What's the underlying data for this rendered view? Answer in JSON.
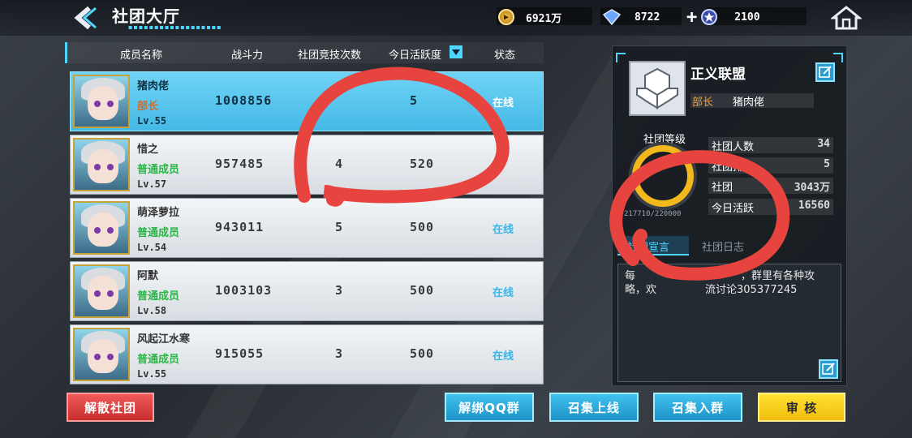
{
  "header": {
    "title": "社团大厅",
    "gold": "6921万",
    "gems": "8722",
    "tickets": "2100",
    "colors": {
      "accent": "#4fd6ff",
      "gold": "#f6c24b"
    }
  },
  "columns": [
    "成员名称",
    "战斗力",
    "社团竞技次数",
    "今日活跃度",
    "状态"
  ],
  "members": [
    {
      "name": "猪肉佬",
      "rank": "部长",
      "level": "Lv.55",
      "power": "1008856",
      "count": "",
      "activity": "5",
      "status": "在线"
    },
    {
      "name": "惜之",
      "rank": "普通成员",
      "level": "Lv.57",
      "power": "957485",
      "count": "4",
      "activity": "520",
      "status": ""
    },
    {
      "name": "萌泽萝拉",
      "rank": "普通成员",
      "level": "Lv.54",
      "power": "943011",
      "count": "5",
      "activity": "500",
      "status": "在线"
    },
    {
      "name": "阿默",
      "rank": "普通成员",
      "level": "Lv.58",
      "power": "1003103",
      "count": "3",
      "activity": "500",
      "status": "在线"
    },
    {
      "name": "风起江水寒",
      "rank": "普通成员",
      "level": "Lv.55",
      "power": "915055",
      "count": "3",
      "activity": "500",
      "status": "在线"
    }
  ],
  "club": {
    "name": "正义联盟",
    "leader_label": "部长",
    "leader_name": "猪肉佬",
    "level_label": "社团等级",
    "exp": "217710/220000",
    "stats": [
      {
        "k": "社团人数",
        "v": "34"
      },
      {
        "k": "社团排名",
        "v": "5"
      },
      {
        "k": "社团",
        "v": "3043万"
      },
      {
        "k": "今日活跃",
        "v": "16560"
      }
    ],
    "tab_active": "社团宣言",
    "tab_inactive": "社团日志",
    "notice_line1": "每",
    "notice_line1b": "，群里有各种攻",
    "notice_line2": "略，欢",
    "notice_line2b": "流讨论305377245"
  },
  "buttons": {
    "disband": "解散社团",
    "unbind_qq": "解绑QQ群",
    "summon_online": "召集上线",
    "summon_join": "召集入群",
    "review": "审 核"
  }
}
